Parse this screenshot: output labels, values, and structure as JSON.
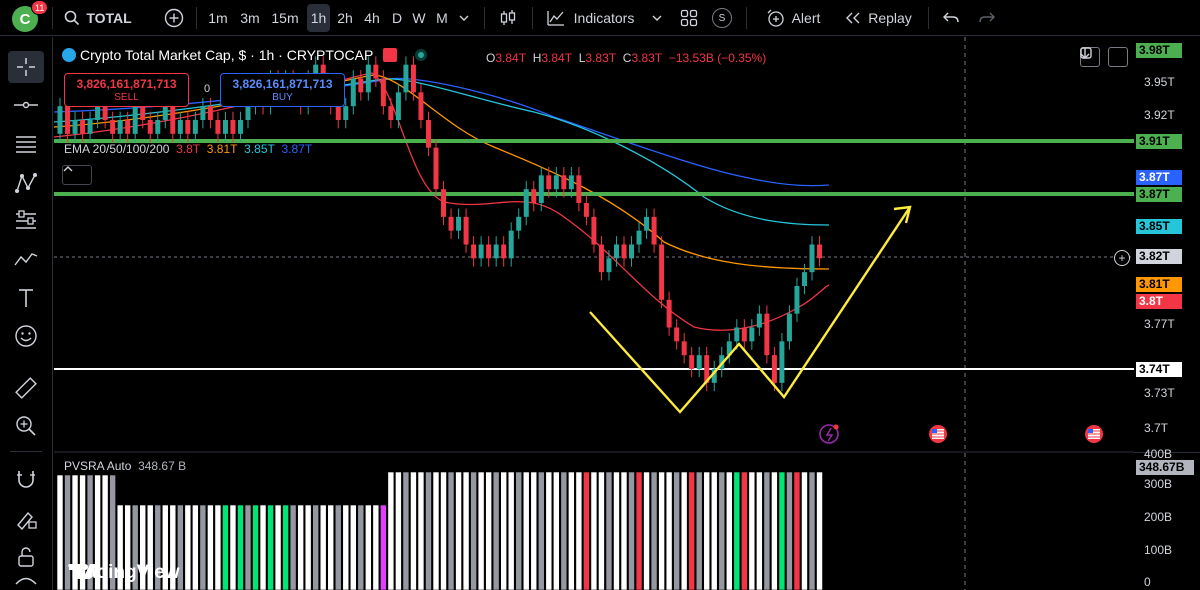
{
  "topbar": {
    "avatar_letter": "C",
    "notification_count": "11",
    "symbol": "TOTAL",
    "timeframes": [
      "1m",
      "3m",
      "15m",
      "1h",
      "2h",
      "4h",
      "D",
      "W",
      "M"
    ],
    "active_timeframe": "1h",
    "indicators_label": "Indicators",
    "s_label": "S",
    "alert_label": "Alert",
    "replay_label": "Replay"
  },
  "legend": {
    "title": "Crypto Total Market Cap, $ · 1h · CRYPTOCAP",
    "open_label": "O",
    "open_value": "3.84T",
    "high_label": "H",
    "high_value": "3.84T",
    "low_label": "L",
    "low_value": "3.83T",
    "close_label": "C",
    "close_value": "3.83T",
    "change": "−13.53B (−0.35%)"
  },
  "trade": {
    "sell_price": "3,826,161,871,713",
    "sell_label": "SELL",
    "spread": "0",
    "buy_price": "3,826,161,871,713",
    "buy_label": "BUY"
  },
  "ema": {
    "label": "EMA 20/50/100/200",
    "v20": "3.8T",
    "v50": "3.81T",
    "v100": "3.85T",
    "v200": "3.87T",
    "colors": {
      "ema20": "#f23645",
      "ema50": "#ff9800",
      "ema100": "#26c6da",
      "ema200": "#2962ff"
    }
  },
  "pvsra": {
    "label": "PVSRA Auto",
    "value": "348.67 B"
  },
  "watermark": "TradingView",
  "price_axis": {
    "ticks": [
      "3.98T",
      "3.95T",
      "3.92T",
      "3.77T",
      "3.73T",
      "3.7T"
    ],
    "labels": {
      "hline_top": "3.98T",
      "hline_391": "3.91T",
      "ema200": "3.87T",
      "hline_387": "3.87T",
      "ema100": "3.85T",
      "crosshair": "3.82T",
      "ema50": "3.81T",
      "ema20": "3.8T",
      "hline_374": "3.74T"
    },
    "volume_ticks": [
      "400B",
      "300B",
      "200B",
      "100B",
      "0"
    ],
    "volume_label": "348.67B"
  },
  "chart_data": {
    "type": "candlestick",
    "ylim": [
      3.69,
      3.99
    ],
    "horizontal_lines": [
      3.91,
      3.87,
      3.74
    ],
    "candles": [
      [
        3.92,
        3.94
      ],
      [
        3.94,
        3.92
      ],
      [
        3.92,
        3.93
      ],
      [
        3.93,
        3.92
      ],
      [
        3.92,
        3.93
      ],
      [
        3.93,
        3.95
      ],
      [
        3.95,
        3.93
      ],
      [
        3.93,
        3.92
      ],
      [
        3.92,
        3.93
      ],
      [
        3.93,
        3.92
      ],
      [
        3.92,
        3.94
      ],
      [
        3.94,
        3.93
      ],
      [
        3.93,
        3.92
      ],
      [
        3.92,
        3.93
      ],
      [
        3.93,
        3.94
      ],
      [
        3.94,
        3.92
      ],
      [
        3.92,
        3.93
      ],
      [
        3.93,
        3.92
      ],
      [
        3.92,
        3.93
      ],
      [
        3.93,
        3.94
      ],
      [
        3.94,
        3.93
      ],
      [
        3.93,
        3.92
      ],
      [
        3.92,
        3.93
      ],
      [
        3.93,
        3.92
      ],
      [
        3.92,
        3.93
      ],
      [
        3.93,
        3.94
      ],
      [
        3.94,
        3.95
      ],
      [
        3.95,
        3.94
      ],
      [
        3.94,
        3.96
      ],
      [
        3.96,
        3.95
      ],
      [
        3.95,
        3.96
      ],
      [
        3.96,
        3.95
      ],
      [
        3.95,
        3.94
      ],
      [
        3.94,
        3.96
      ],
      [
        3.96,
        3.97
      ],
      [
        3.97,
        3.95
      ],
      [
        3.95,
        3.94
      ],
      [
        3.94,
        3.93
      ],
      [
        3.93,
        3.94
      ],
      [
        3.94,
        3.96
      ],
      [
        3.96,
        3.95
      ],
      [
        3.95,
        3.97
      ],
      [
        3.97,
        3.96
      ],
      [
        3.96,
        3.94
      ],
      [
        3.94,
        3.93
      ],
      [
        3.93,
        3.95
      ],
      [
        3.95,
        3.97
      ],
      [
        3.97,
        3.95
      ],
      [
        3.95,
        3.93
      ],
      [
        3.93,
        3.91
      ],
      [
        3.91,
        3.88
      ],
      [
        3.88,
        3.86
      ],
      [
        3.86,
        3.85
      ],
      [
        3.85,
        3.86
      ],
      [
        3.86,
        3.84
      ],
      [
        3.84,
        3.83
      ],
      [
        3.83,
        3.84
      ],
      [
        3.84,
        3.83
      ],
      [
        3.83,
        3.84
      ],
      [
        3.84,
        3.83
      ],
      [
        3.83,
        3.85
      ],
      [
        3.85,
        3.86
      ],
      [
        3.86,
        3.88
      ],
      [
        3.88,
        3.87
      ],
      [
        3.87,
        3.89
      ],
      [
        3.89,
        3.88
      ],
      [
        3.88,
        3.89
      ],
      [
        3.89,
        3.88
      ],
      [
        3.88,
        3.89
      ],
      [
        3.89,
        3.87
      ],
      [
        3.87,
        3.86
      ],
      [
        3.86,
        3.84
      ],
      [
        3.84,
        3.82
      ],
      [
        3.82,
        3.83
      ],
      [
        3.83,
        3.84
      ],
      [
        3.84,
        3.83
      ],
      [
        3.83,
        3.84
      ],
      [
        3.84,
        3.85
      ],
      [
        3.85,
        3.86
      ],
      [
        3.86,
        3.84
      ],
      [
        3.84,
        3.8
      ],
      [
        3.8,
        3.78
      ],
      [
        3.78,
        3.77
      ],
      [
        3.77,
        3.76
      ],
      [
        3.76,
        3.75
      ],
      [
        3.75,
        3.76
      ],
      [
        3.76,
        3.74
      ],
      [
        3.74,
        3.75
      ],
      [
        3.75,
        3.76
      ],
      [
        3.76,
        3.77
      ],
      [
        3.77,
        3.78
      ],
      [
        3.78,
        3.77
      ],
      [
        3.77,
        3.78
      ],
      [
        3.78,
        3.79
      ],
      [
        3.79,
        3.76
      ],
      [
        3.76,
        3.74
      ],
      [
        3.74,
        3.77
      ],
      [
        3.77,
        3.79
      ],
      [
        3.79,
        3.81
      ],
      [
        3.81,
        3.82
      ],
      [
        3.82,
        3.84
      ],
      [
        3.84,
        3.83
      ]
    ]
  }
}
